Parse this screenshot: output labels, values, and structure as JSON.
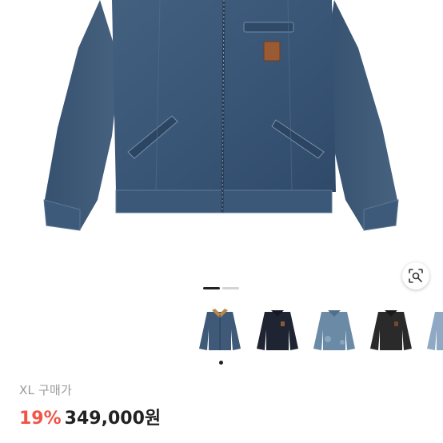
{
  "product": {
    "size_label": "XL",
    "purchase_label": "구매가",
    "discount": "19%",
    "price": "349,000원"
  },
  "gallery": {
    "pages_total": 2,
    "current_page": 1,
    "thumbnails": [
      {
        "name": "thumb-blue-denim-corduroy-collar",
        "color": "#3f5a78"
      },
      {
        "name": "thumb-navy-jacket",
        "color": "#1f2433"
      },
      {
        "name": "thumb-light-denim-jacket",
        "color": "#6a8aa6"
      },
      {
        "name": "thumb-black-jacket",
        "color": "#2a2a2a"
      },
      {
        "name": "thumb-pale-denim-jacket",
        "color": "#8fa9c4"
      }
    ]
  },
  "icons": {
    "lens": "lens-search-icon",
    "leather_patch": "brand-patch-icon"
  },
  "colors": {
    "discount": "#f05647",
    "price": "#222222",
    "meta": "#9a9a9a",
    "denim": "#3a5677"
  }
}
